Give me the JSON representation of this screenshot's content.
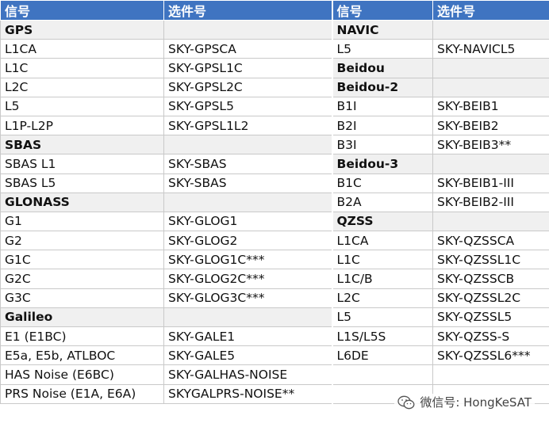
{
  "headers": {
    "signal": "信号",
    "option": "选件号"
  },
  "rows": [
    {
      "l": {
        "s": "GPS",
        "o": "",
        "g": true
      },
      "r": {
        "s": "NAVIC",
        "o": "",
        "g": true
      }
    },
    {
      "l": {
        "s": "L1CA",
        "o": "SKY-GPSCA"
      },
      "r": {
        "s": "L5",
        "o": "SKY-NAVICL5"
      }
    },
    {
      "l": {
        "s": "L1C",
        "o": "SKY-GPSL1C"
      },
      "r": {
        "s": "Beidou",
        "o": "",
        "g": true
      }
    },
    {
      "l": {
        "s": "L2C",
        "o": "SKY-GPSL2C"
      },
      "r": {
        "s": "Beidou-2",
        "o": "",
        "g": true
      }
    },
    {
      "l": {
        "s": "L5",
        "o": "SKY-GPSL5"
      },
      "r": {
        "s": "B1I",
        "o": "SKY-BEIB1"
      }
    },
    {
      "l": {
        "s": "L1P-L2P",
        "o": "SKY-GPSL1L2"
      },
      "r": {
        "s": "B2I",
        "o": "SKY-BEIB2"
      }
    },
    {
      "l": {
        "s": "SBAS",
        "o": "",
        "g": true
      },
      "r": {
        "s": "B3I",
        "o": "SKY-BEIB3**"
      }
    },
    {
      "l": {
        "s": "SBAS L1",
        "o": "SKY-SBAS"
      },
      "r": {
        "s": "Beidou-3",
        "o": "",
        "g": true
      }
    },
    {
      "l": {
        "s": "SBAS L5",
        "o": "SKY-SBAS"
      },
      "r": {
        "s": "B1C",
        "o": "SKY-BEIB1-III"
      }
    },
    {
      "l": {
        "s": "GLONASS",
        "o": "",
        "g": true
      },
      "r": {
        "s": "B2A",
        "o": "SKY-BEIB2-III"
      }
    },
    {
      "l": {
        "s": "G1",
        "o": "SKY-GLOG1"
      },
      "r": {
        "s": "QZSS",
        "o": "",
        "g": true
      }
    },
    {
      "l": {
        "s": "G2",
        "o": "SKY-GLOG2"
      },
      "r": {
        "s": "L1CA",
        "o": "SKY-QZSSCA"
      }
    },
    {
      "l": {
        "s": "G1C",
        "o": "SKY-GLOG1C***"
      },
      "r": {
        "s": "L1C",
        "o": "SKY-QZSSL1C"
      }
    },
    {
      "l": {
        "s": "G2C",
        "o": "SKY-GLOG2C***"
      },
      "r": {
        "s": "L1C/B",
        "o": "SKY-QZSSCB"
      }
    },
    {
      "l": {
        "s": "G3C",
        "o": "SKY-GLOG3C***"
      },
      "r": {
        "s": "L2C",
        "o": "SKY-QZSSL2C"
      }
    },
    {
      "l": {
        "s": "Galileo",
        "o": "",
        "g": true
      },
      "r": {
        "s": "L5",
        "o": "SKY-QZSSL5"
      }
    },
    {
      "l": {
        "s": "E1 (E1BC)",
        "o": "SKY-GALE1"
      },
      "r": {
        "s": "L1S/L5S",
        "o": "SKY-QZSS-S"
      }
    },
    {
      "l": {
        "s": "E5a, E5b, ATLBOC",
        "o": "SKY-GALE5"
      },
      "r": {
        "s": "L6DE",
        "o": "SKY-QZSSL6***"
      }
    },
    {
      "l": {
        "s": "HAS Noise (E6BC)",
        "o": "SKY-GALHAS-NOISE"
      },
      "r": {
        "s": "",
        "o": ""
      }
    },
    {
      "l": {
        "s": "PRS Noise (E1A, E6A)",
        "o": "SKYGALPRS-NOISE**"
      },
      "r": {
        "s": "",
        "o": ""
      }
    }
  ],
  "watermark": {
    "text": "微信号: HongKeSAT",
    "icon": "wechat-icon"
  }
}
